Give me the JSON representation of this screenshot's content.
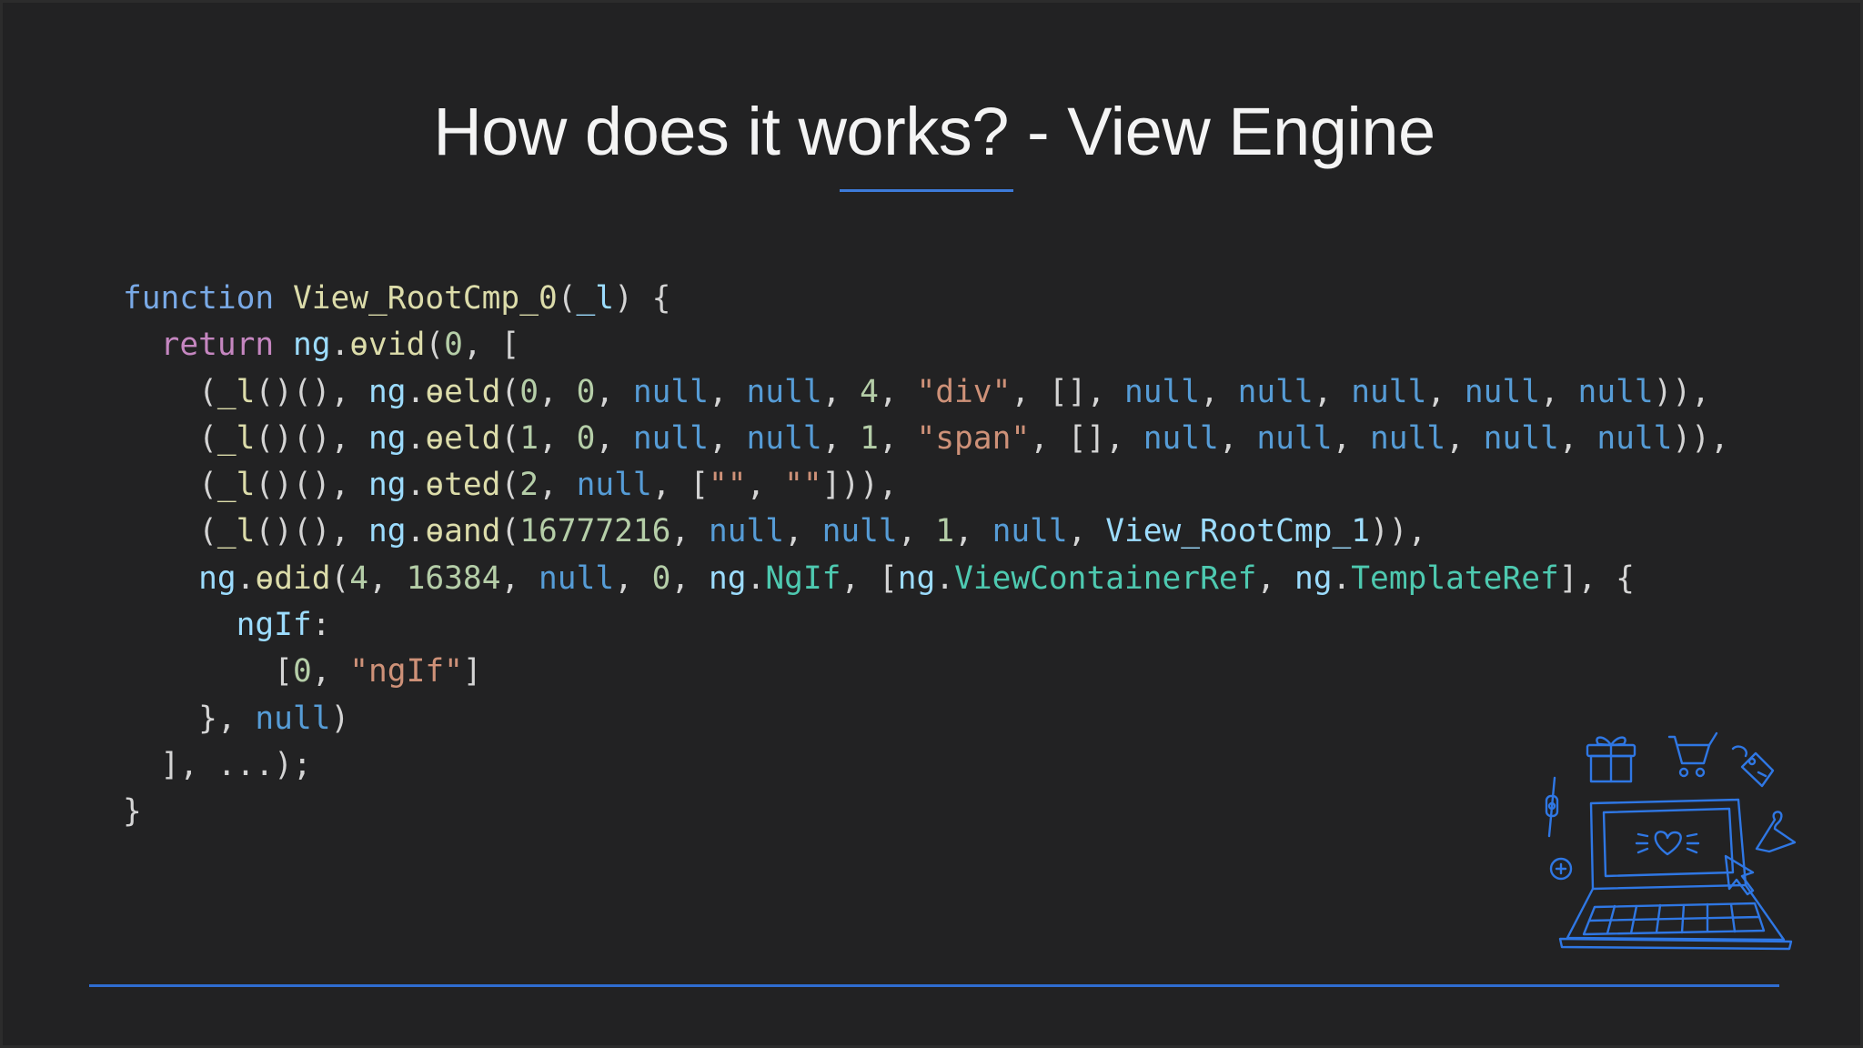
{
  "slide": {
    "title": "How does it works? - View Engine",
    "accent_color": "#3d7bd9",
    "illustration": "laptop-shopping-icon"
  },
  "code": {
    "language": "javascript",
    "lines": [
      [
        [
          "kw",
          "function"
        ],
        [
          "pun",
          " "
        ],
        [
          "fn",
          "View_RootCmp_0"
        ],
        [
          "pun",
          "("
        ],
        [
          "id",
          "_l"
        ],
        [
          "pun",
          ") {"
        ]
      ],
      [
        [
          "pun",
          "  "
        ],
        [
          "ret",
          "return"
        ],
        [
          "pun",
          " "
        ],
        [
          "id",
          "ng"
        ],
        [
          "pun",
          "."
        ],
        [
          "fn",
          "ɵvid"
        ],
        [
          "pun",
          "("
        ],
        [
          "num",
          "0"
        ],
        [
          "pun",
          ", ["
        ]
      ],
      [
        [
          "pun",
          "    ("
        ],
        [
          "fn",
          "_l"
        ],
        [
          "pun",
          "()(), "
        ],
        [
          "id",
          "ng"
        ],
        [
          "pun",
          "."
        ],
        [
          "fn",
          "ɵeld"
        ],
        [
          "pun",
          "("
        ],
        [
          "num",
          "0"
        ],
        [
          "pun",
          ", "
        ],
        [
          "num",
          "0"
        ],
        [
          "pun",
          ", "
        ],
        [
          "nul",
          "null"
        ],
        [
          "pun",
          ", "
        ],
        [
          "nul",
          "null"
        ],
        [
          "pun",
          ", "
        ],
        [
          "num",
          "4"
        ],
        [
          "pun",
          ", "
        ],
        [
          "str",
          "\"div\""
        ],
        [
          "pun",
          ", [], "
        ],
        [
          "nul",
          "null"
        ],
        [
          "pun",
          ", "
        ],
        [
          "nul",
          "null"
        ],
        [
          "pun",
          ", "
        ],
        [
          "nul",
          "null"
        ],
        [
          "pun",
          ", "
        ],
        [
          "nul",
          "null"
        ],
        [
          "pun",
          ", "
        ],
        [
          "nul",
          "null"
        ],
        [
          "pun",
          ")),"
        ]
      ],
      [
        [
          "pun",
          "    ("
        ],
        [
          "fn",
          "_l"
        ],
        [
          "pun",
          "()(), "
        ],
        [
          "id",
          "ng"
        ],
        [
          "pun",
          "."
        ],
        [
          "fn",
          "ɵeld"
        ],
        [
          "pun",
          "("
        ],
        [
          "num",
          "1"
        ],
        [
          "pun",
          ", "
        ],
        [
          "num",
          "0"
        ],
        [
          "pun",
          ", "
        ],
        [
          "nul",
          "null"
        ],
        [
          "pun",
          ", "
        ],
        [
          "nul",
          "null"
        ],
        [
          "pun",
          ", "
        ],
        [
          "num",
          "1"
        ],
        [
          "pun",
          ", "
        ],
        [
          "str",
          "\"span\""
        ],
        [
          "pun",
          ", [], "
        ],
        [
          "nul",
          "null"
        ],
        [
          "pun",
          ", "
        ],
        [
          "nul",
          "null"
        ],
        [
          "pun",
          ", "
        ],
        [
          "nul",
          "null"
        ],
        [
          "pun",
          ", "
        ],
        [
          "nul",
          "null"
        ],
        [
          "pun",
          ", "
        ],
        [
          "nul",
          "null"
        ],
        [
          "pun",
          ")),"
        ]
      ],
      [
        [
          "pun",
          "    ("
        ],
        [
          "fn",
          "_l"
        ],
        [
          "pun",
          "()(), "
        ],
        [
          "id",
          "ng"
        ],
        [
          "pun",
          "."
        ],
        [
          "fn",
          "ɵted"
        ],
        [
          "pun",
          "("
        ],
        [
          "num",
          "2"
        ],
        [
          "pun",
          ", "
        ],
        [
          "nul",
          "null"
        ],
        [
          "pun",
          ", ["
        ],
        [
          "str",
          "\"\""
        ],
        [
          "pun",
          ", "
        ],
        [
          "str",
          "\"\""
        ],
        [
          "pun",
          "])),"
        ]
      ],
      [
        [
          "pun",
          "    ("
        ],
        [
          "fn",
          "_l"
        ],
        [
          "pun",
          "()(), "
        ],
        [
          "id",
          "ng"
        ],
        [
          "pun",
          "."
        ],
        [
          "fn",
          "ɵand"
        ],
        [
          "pun",
          "("
        ],
        [
          "num",
          "16777216"
        ],
        [
          "pun",
          ", "
        ],
        [
          "nul",
          "null"
        ],
        [
          "pun",
          ", "
        ],
        [
          "nul",
          "null"
        ],
        [
          "pun",
          ", "
        ],
        [
          "num",
          "1"
        ],
        [
          "pun",
          ", "
        ],
        [
          "nul",
          "null"
        ],
        [
          "pun",
          ", "
        ],
        [
          "id",
          "View_RootCmp_1"
        ],
        [
          "pun",
          ")),"
        ]
      ],
      [
        [
          "pun",
          "    "
        ],
        [
          "id",
          "ng"
        ],
        [
          "pun",
          "."
        ],
        [
          "fn",
          "ɵdid"
        ],
        [
          "pun",
          "("
        ],
        [
          "num",
          "4"
        ],
        [
          "pun",
          ", "
        ],
        [
          "num",
          "16384"
        ],
        [
          "pun",
          ", "
        ],
        [
          "nul",
          "null"
        ],
        [
          "pun",
          ", "
        ],
        [
          "num",
          "0"
        ],
        [
          "pun",
          ", "
        ],
        [
          "id",
          "ng"
        ],
        [
          "pun",
          "."
        ],
        [
          "ty",
          "NgIf"
        ],
        [
          "pun",
          ", ["
        ],
        [
          "id",
          "ng"
        ],
        [
          "pun",
          "."
        ],
        [
          "ty",
          "ViewContainerRef"
        ],
        [
          "pun",
          ", "
        ],
        [
          "id",
          "ng"
        ],
        [
          "pun",
          "."
        ],
        [
          "ty",
          "TemplateRef"
        ],
        [
          "pun",
          "], {"
        ]
      ],
      [
        [
          "pun",
          "      "
        ],
        [
          "id",
          "ngIf"
        ],
        [
          "pun",
          ":"
        ]
      ],
      [
        [
          "pun",
          "        ["
        ],
        [
          "num",
          "0"
        ],
        [
          "pun",
          ", "
        ],
        [
          "str",
          "\"ngIf\""
        ],
        [
          "pun",
          "]"
        ]
      ],
      [
        [
          "pun",
          "    }, "
        ],
        [
          "nul",
          "null"
        ],
        [
          "pun",
          ")"
        ]
      ],
      [
        [
          "pun",
          "  ], ...);"
        ]
      ],
      [
        [
          "pun",
          "}"
        ]
      ]
    ]
  }
}
